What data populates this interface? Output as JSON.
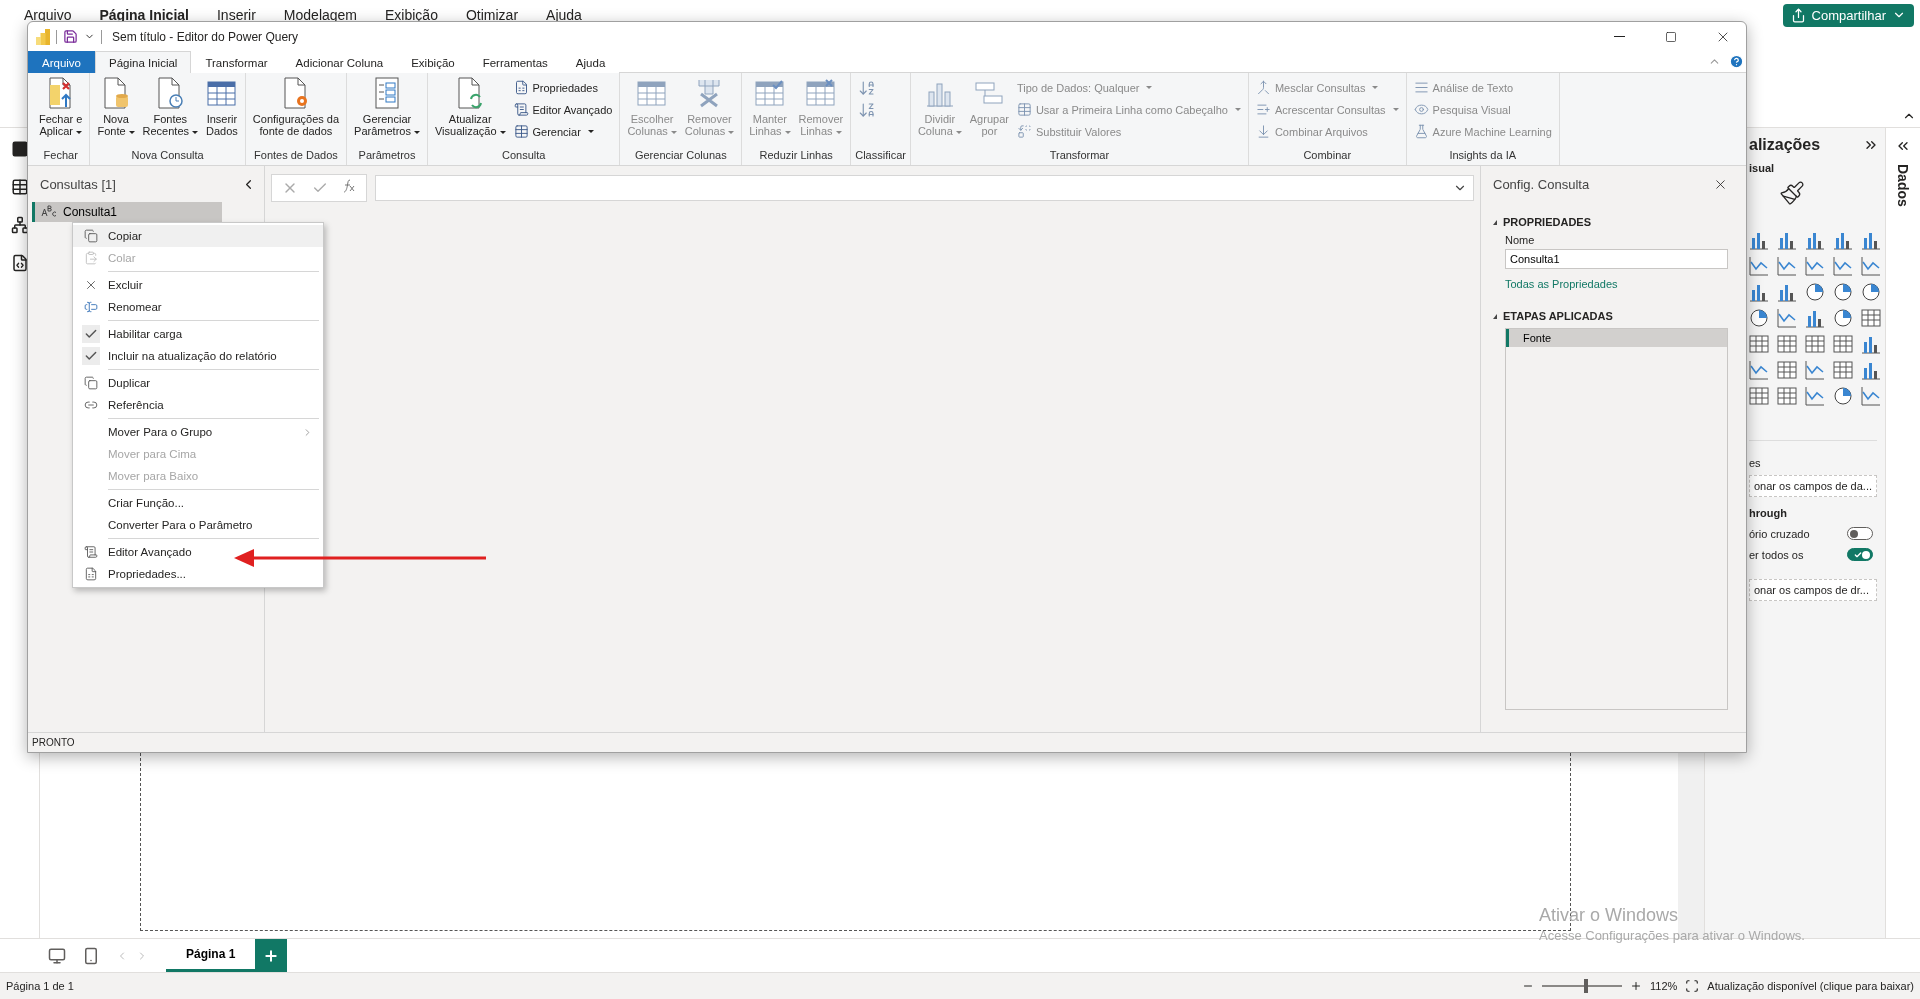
{
  "app": {
    "menu": [
      {
        "label": "Arquivo",
        "selected": false
      },
      {
        "label": "Página Inicial",
        "selected": true
      },
      {
        "label": "Inserir",
        "selected": false
      },
      {
        "label": "Modelagem",
        "selected": false
      },
      {
        "label": "Exibição",
        "selected": false
      },
      {
        "label": "Otimizar",
        "selected": false
      },
      {
        "label": "Ajuda",
        "selected": false
      }
    ],
    "share_button": "Compartilhar",
    "visualizations": {
      "title": "alizações",
      "build_tab": "isual",
      "section_label": "es",
      "field_well": "onar os campos de da...",
      "drillthrough_label": "hrough",
      "toggles": [
        {
          "label": "ório cruzado",
          "on": false
        },
        {
          "label": "er todos os",
          "on": true
        }
      ],
      "drillthrough_well": "onar os campos de dr..."
    },
    "data_tab": "Dados",
    "page_tabs": [
      {
        "label": "Página 1",
        "selected": true
      }
    ],
    "status_bar": {
      "page": "Página 1 de 1",
      "zoom_slider": {
        "level": 0.55
      },
      "zoom": "112%",
      "update": "Atualização disponível (clique para baixar)"
    },
    "activation_notice": {
      "title": "Ativar o Windows",
      "text": "Acesse Configurações para ativar o Windows."
    }
  },
  "power_query": {
    "title": "Sem título - Editor do Power Query",
    "tabs": [
      {
        "label": "Arquivo",
        "kind": "file",
        "selected": false
      },
      {
        "label": "Página Inicial",
        "kind": "tab",
        "selected": true
      },
      {
        "label": "Transformar",
        "kind": "tab",
        "selected": false
      },
      {
        "label": "Adicionar Coluna",
        "kind": "tab",
        "selected": false
      },
      {
        "label": "Exibição",
        "kind": "tab",
        "selected": false
      },
      {
        "label": "Ferramentas",
        "kind": "tab",
        "selected": false
      },
      {
        "label": "Ajuda",
        "kind": "tab",
        "selected": false
      }
    ],
    "ribbon": [
      {
        "label": "Fechar",
        "buttons": [
          {
            "kind": "large",
            "lines": [
              "Fechar e",
              "Aplicar"
            ],
            "dropdown": true,
            "disabled": false
          }
        ]
      },
      {
        "label": "Nova Consulta",
        "buttons": [
          {
            "kind": "large",
            "lines": [
              "Nova",
              "Fonte"
            ],
            "dropdown": true,
            "disabled": false
          },
          {
            "kind": "large",
            "lines": [
              "Fontes",
              "Recentes"
            ],
            "dropdown": true,
            "disabled": false
          },
          {
            "kind": "large",
            "lines": [
              "Inserir",
              "Dados"
            ],
            "dropdown": false,
            "disabled": false
          }
        ]
      },
      {
        "label": "Fontes de Dados",
        "buttons": [
          {
            "kind": "large",
            "lines": [
              "Configurações da",
              "fonte de dados"
            ],
            "dropdown": false,
            "disabled": false
          }
        ]
      },
      {
        "label": "Parâmetros",
        "buttons": [
          {
            "kind": "large",
            "lines": [
              "Gerenciar",
              "Parâmetros"
            ],
            "dropdown": true,
            "disabled": false
          }
        ]
      },
      {
        "label": "Consulta",
        "buttons": [
          {
            "kind": "large",
            "lines": [
              "Atualizar",
              "Visualização"
            ],
            "dropdown": true,
            "disabled": false
          },
          {
            "kind": "small",
            "lines": [
              "Propriedades"
            ],
            "dropdown": false,
            "disabled": false
          },
          {
            "kind": "small",
            "lines": [
              "Editor Avançado"
            ],
            "dropdown": false,
            "disabled": false
          },
          {
            "kind": "small",
            "lines": [
              "Gerenciar"
            ],
            "dropdown": true,
            "disabled": false
          }
        ]
      },
      {
        "label": "Gerenciar Colunas",
        "buttons": [
          {
            "kind": "large",
            "lines": [
              "Escolher",
              "Colunas"
            ],
            "dropdown": true,
            "disabled": true
          },
          {
            "kind": "large",
            "lines": [
              "Remover",
              "Colunas"
            ],
            "dropdown": true,
            "disabled": true
          }
        ]
      },
      {
        "label": "Reduzir Linhas",
        "buttons": [
          {
            "kind": "large",
            "lines": [
              "Manter",
              "Linhas"
            ],
            "dropdown": true,
            "disabled": true
          },
          {
            "kind": "large",
            "lines": [
              "Remover",
              "Linhas"
            ],
            "dropdown": true,
            "disabled": true
          }
        ]
      },
      {
        "label": "Classificar",
        "buttons": [
          {
            "kind": "icon",
            "dropdown": false,
            "disabled": true
          },
          {
            "kind": "icon",
            "dropdown": false,
            "disabled": true
          }
        ]
      },
      {
        "label": "Transformar",
        "buttons": [
          {
            "kind": "large",
            "lines": [
              "Dividir",
              "Coluna"
            ],
            "dropdown": true,
            "disabled": true
          },
          {
            "kind": "large",
            "lines": [
              "Agrupar",
              "por"
            ],
            "dropdown": false,
            "disabled": true
          },
          {
            "kind": "small",
            "lines": [
              "Tipo de Dados: Qualquer"
            ],
            "dropdown": true,
            "disabled": true
          },
          {
            "kind": "small",
            "lines": [
              "Usar a Primeira Linha como Cabeçalho"
            ],
            "dropdown": true,
            "disabled": true
          },
          {
            "kind": "small",
            "lines": [
              "Substituir Valores"
            ],
            "dropdown": false,
            "disabled": true
          }
        ]
      },
      {
        "label": "Combinar",
        "buttons": [
          {
            "kind": "small",
            "lines": [
              "Mesclar Consultas"
            ],
            "dropdown": true,
            "disabled": true
          },
          {
            "kind": "small",
            "lines": [
              "Acrescentar Consultas"
            ],
            "dropdown": true,
            "disabled": true
          },
          {
            "kind": "small",
            "lines": [
              "Combinar Arquivos"
            ],
            "dropdown": false,
            "disabled": true
          }
        ]
      },
      {
        "label": "Insights da IA",
        "buttons": [
          {
            "kind": "small",
            "lines": [
              "Análise de Texto"
            ],
            "dropdown": false,
            "disabled": true
          },
          {
            "kind": "small",
            "lines": [
              "Pesquisa Visual"
            ],
            "dropdown": false,
            "disabled": true
          },
          {
            "kind": "small",
            "lines": [
              "Azure Machine Learning"
            ],
            "dropdown": false,
            "disabled": true
          }
        ]
      }
    ],
    "queries": {
      "title": "Consultas [1]",
      "items": [
        {
          "label": "Consulta1",
          "selected": true
        }
      ]
    },
    "context_menu": [
      {
        "kind": "item",
        "label": "Copiar",
        "selected": true,
        "disabled": false,
        "checked": false,
        "submenu": false
      },
      {
        "kind": "item",
        "label": "Colar",
        "selected": false,
        "disabled": true,
        "checked": false,
        "submenu": false
      },
      {
        "kind": "separator"
      },
      {
        "kind": "item",
        "label": "Excluir",
        "selected": false,
        "disabled": false,
        "checked": false,
        "submenu": false
      },
      {
        "kind": "item",
        "label": "Renomear",
        "selected": false,
        "disabled": false,
        "checked": false,
        "submenu": false
      },
      {
        "kind": "separator"
      },
      {
        "kind": "item",
        "label": "Habilitar carga",
        "selected": false,
        "disabled": false,
        "checked": true,
        "submenu": false
      },
      {
        "kind": "item",
        "label": "Incluir na atualização do relatório",
        "selected": false,
        "disabled": false,
        "checked": true,
        "submenu": false
      },
      {
        "kind": "separator"
      },
      {
        "kind": "item",
        "label": "Duplicar",
        "selected": false,
        "disabled": false,
        "checked": false,
        "submenu": false
      },
      {
        "kind": "item",
        "label": "Referência",
        "selected": false,
        "disabled": false,
        "checked": false,
        "submenu": false
      },
      {
        "kind": "separator"
      },
      {
        "kind": "item",
        "label": "Mover Para o Grupo",
        "selected": false,
        "disabled": false,
        "checked": false,
        "submenu": true
      },
      {
        "kind": "item",
        "label": "Mover para Cima",
        "selected": false,
        "disabled": true,
        "checked": false,
        "submenu": false
      },
      {
        "kind": "item",
        "label": "Mover para Baixo",
        "selected": false,
        "disabled": true,
        "checked": false,
        "submenu": false
      },
      {
        "kind": "separator"
      },
      {
        "kind": "item",
        "label": "Criar Função...",
        "selected": false,
        "disabled": false,
        "checked": false,
        "submenu": false
      },
      {
        "kind": "item",
        "label": "Converter Para o Parâmetro",
        "selected": false,
        "disabled": false,
        "checked": false,
        "submenu": false
      },
      {
        "kind": "separator"
      },
      {
        "kind": "item",
        "label": "Editor Avançado",
        "selected": false,
        "disabled": false,
        "checked": false,
        "submenu": false
      },
      {
        "kind": "item",
        "label": "Propriedades...",
        "selected": false,
        "disabled": false,
        "checked": false,
        "submenu": false
      }
    ],
    "settings": {
      "title": "Config. Consulta",
      "properties_heading": "PROPRIEDADES",
      "name_label": "Nome",
      "name_value": "Consulta1",
      "all_properties_link": "Todas as Propriedades",
      "steps_heading": "ETAPAS APLICADAS",
      "steps": [
        {
          "label": "Fonte",
          "selected": true
        }
      ]
    },
    "status": "PRONTO"
  }
}
